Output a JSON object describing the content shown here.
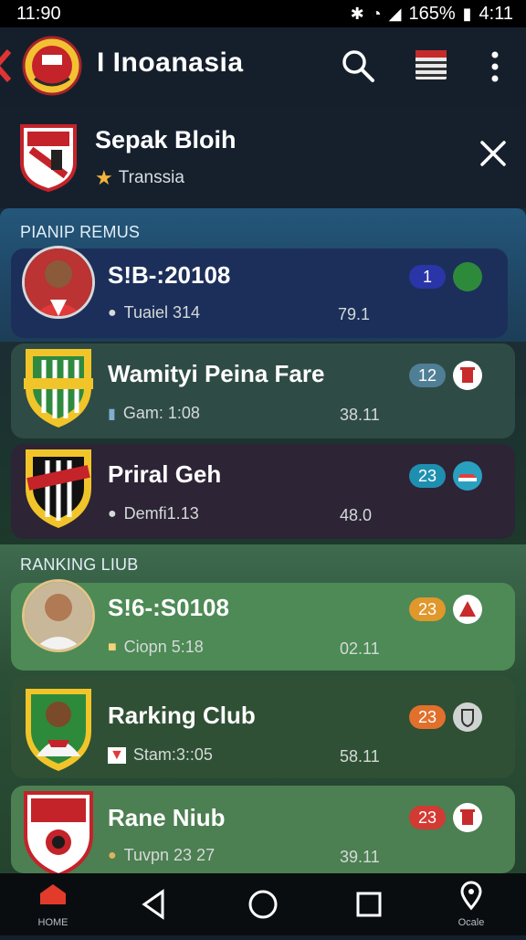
{
  "status_bar": {
    "time": "11:90",
    "battery": "165%",
    "clock": "4:11"
  },
  "app_bar": {
    "title": "I Inoanasia"
  },
  "header": {
    "title": "Sepak Bloih",
    "subtitle": "Transsia"
  },
  "section_1": {
    "label": "PIANIP REMUS",
    "items": [
      {
        "name": "S!B-:20108",
        "meta": "Tuaiel 314",
        "score": "79.1",
        "badge": "1",
        "badge_color": "#2a35a8",
        "bg": "#1c2f5a"
      },
      {
        "name": "Wamityi Peina Fare",
        "meta": "Gam: 1:08",
        "score": "38.11",
        "badge": "12",
        "badge_color": "#4f7f95",
        "bg": "#2f4b45"
      },
      {
        "name": "Priral Geh",
        "meta": "Demfi1.13",
        "score": "48.0",
        "badge": "23",
        "badge_color": "#1f8fb0",
        "bg": "#2d2436"
      }
    ]
  },
  "section_2": {
    "label": "RANKING LIUB",
    "items": [
      {
        "name": "S!6-:S0108",
        "meta": "Ciopn 5:18",
        "score": "02.11",
        "badge": "23",
        "badge_color": "#e0972c",
        "bg": "#4d8a55"
      },
      {
        "name": "Rarking Club",
        "meta": "Stam:3::05",
        "score": "58.11",
        "badge": "23",
        "badge_color": "#e0702b",
        "bg": "#2f5034"
      },
      {
        "name": "Rane Niub",
        "meta": "Tuvpn 23 27",
        "score": "39.11",
        "badge": "23",
        "badge_color": "#d23a33",
        "bg": "#4c7f51"
      }
    ]
  },
  "nav": {
    "home_label": "HOME",
    "location_label": "Ocale"
  },
  "colors": {
    "accent_red": "#d23a33",
    "header_bg": "#151f2c",
    "star": "#f4b63a"
  }
}
